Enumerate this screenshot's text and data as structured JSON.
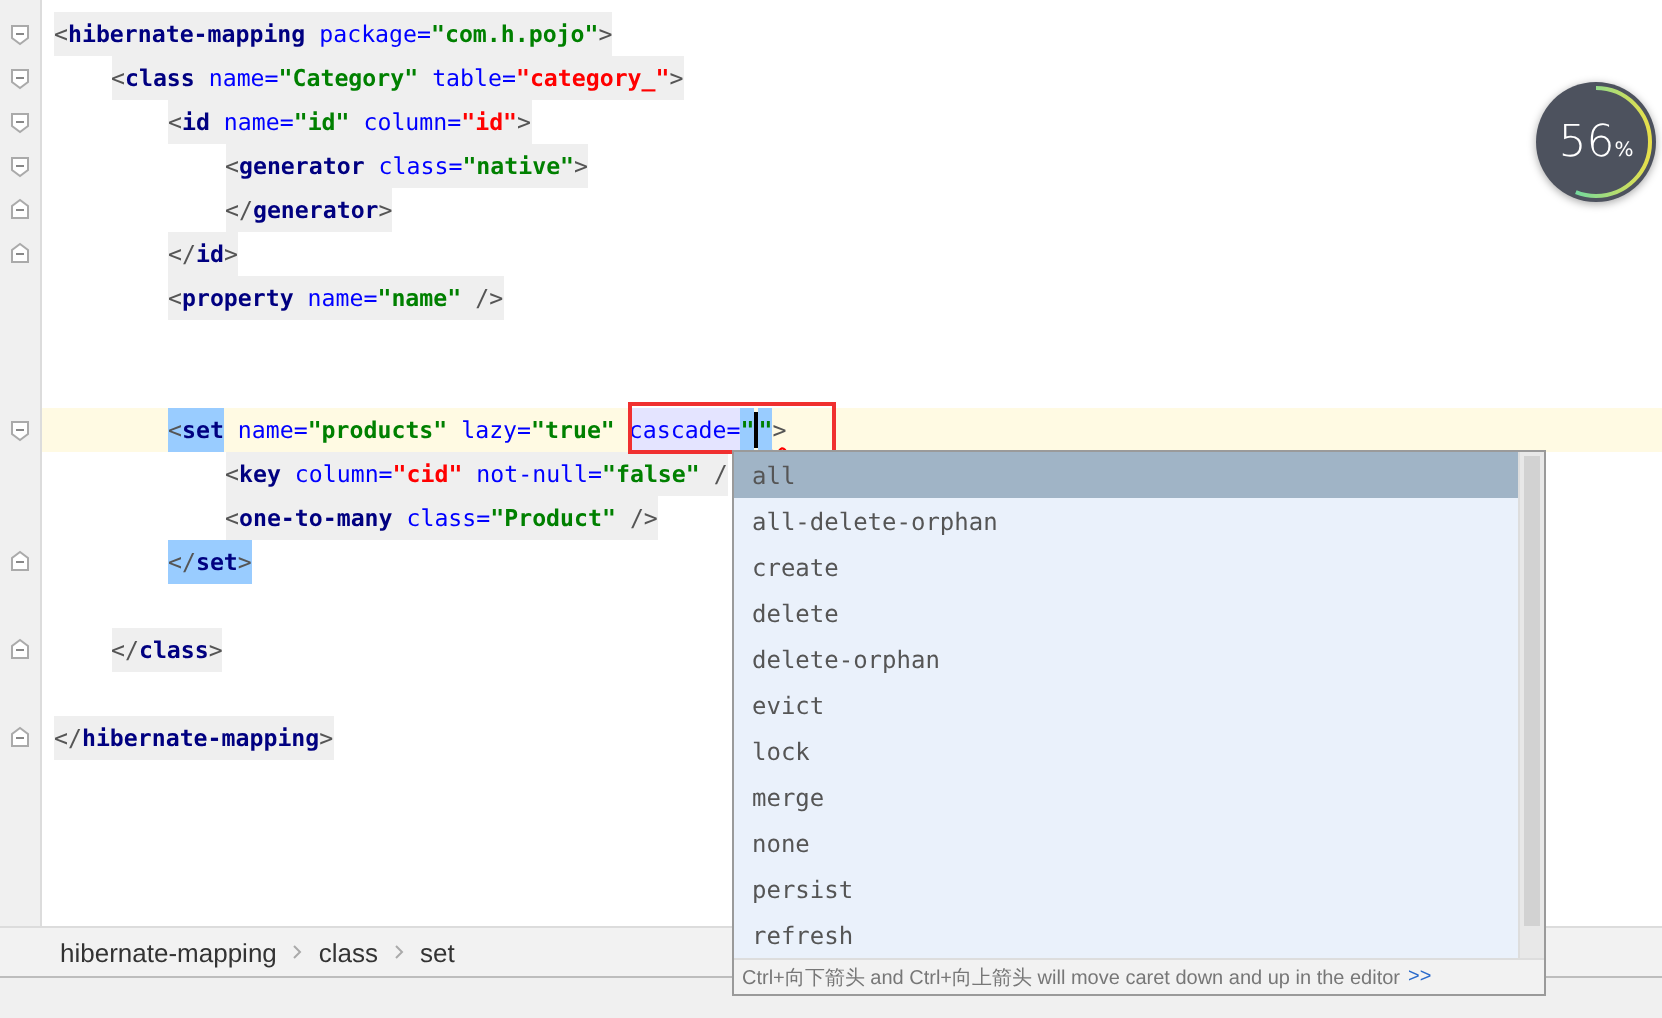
{
  "editor": {
    "lines": [
      {
        "kind": "code",
        "fold_start": true,
        "current": false,
        "tokens": [
          {
            "kind": "bracket",
            "text": "<"
          },
          {
            "kind": "tag",
            "text": "hibernate-mapping"
          },
          {
            "kind": "attr",
            "text": " package="
          },
          {
            "kind": "value",
            "text": "\"com.h.pojo\""
          },
          {
            "kind": "bracket",
            "text": ">"
          }
        ],
        "children": [
          {
            "kind": "code",
            "fold_start": true,
            "current": false,
            "tokens": [
              {
                "kind": "bracket",
                "text": "<"
              },
              {
                "kind": "tag",
                "text": "class"
              },
              {
                "kind": "attr",
                "text": " name="
              },
              {
                "kind": "value",
                "text": "\"Category\""
              },
              {
                "kind": "attr",
                "text": " table="
              },
              {
                "kind": "ref",
                "text": "\"category_\""
              },
              {
                "kind": "bracket",
                "text": ">"
              }
            ],
            "children": [
              {
                "kind": "code",
                "fold_start": true,
                "current": false,
                "tokens": [
                  {
                    "kind": "bracket",
                    "text": "<"
                  },
                  {
                    "kind": "tag",
                    "text": "id"
                  },
                  {
                    "kind": "attr",
                    "text": " name="
                  },
                  {
                    "kind": "value",
                    "text": "\"id\""
                  },
                  {
                    "kind": "attr",
                    "text": " column="
                  },
                  {
                    "kind": "ref",
                    "text": "\"id\""
                  },
                  {
                    "kind": "bracket",
                    "text": ">"
                  }
                ],
                "children": [
                  {
                    "kind": "code",
                    "fold_start": true,
                    "current": false,
                    "tokens": [
                      {
                        "kind": "bracket",
                        "text": "<"
                      },
                      {
                        "kind": "tag",
                        "text": "generator"
                      },
                      {
                        "kind": "attr",
                        "text": " class="
                      },
                      {
                        "kind": "value",
                        "text": "\"native\""
                      },
                      {
                        "kind": "bracket",
                        "text": ">"
                      }
                    ]
                  },
                  {
                    "kind": "code",
                    "fold_end": true,
                    "current": false,
                    "tokens": [
                      {
                        "kind": "bracket",
                        "text": "</"
                      },
                      {
                        "kind": "tag",
                        "text": "generator"
                      },
                      {
                        "kind": "bracket",
                        "text": ">"
                      }
                    ]
                  }
                ]
              },
              {
                "kind": "code",
                "fold_end": true,
                "current": false,
                "tokens": [
                  {
                    "kind": "bracket",
                    "text": "</"
                  },
                  {
                    "kind": "tag",
                    "text": "id"
                  },
                  {
                    "kind": "bracket",
                    "text": ">"
                  }
                ]
              },
              {
                "kind": "code",
                "current": false,
                "tokens": [
                  {
                    "kind": "bracket",
                    "text": "<"
                  },
                  {
                    "kind": "tag",
                    "text": "property"
                  },
                  {
                    "kind": "attr",
                    "text": " name="
                  },
                  {
                    "kind": "value",
                    "text": "\"name\""
                  },
                  {
                    "kind": "bracket",
                    "text": " />"
                  }
                ]
              },
              {
                "kind": "blank"
              },
              {
                "kind": "blank"
              },
              {
                "kind": "code",
                "fold_start": true,
                "current": true,
                "tokens": [
                  {
                    "kind": "bracket",
                    "text": "<",
                    "matched": true
                  },
                  {
                    "kind": "tag",
                    "text": "set",
                    "matched": true
                  },
                  {
                    "kind": "attr",
                    "text": " name="
                  },
                  {
                    "kind": "value",
                    "text": "\"products\""
                  },
                  {
                    "kind": "attr",
                    "text": " lazy="
                  },
                  {
                    "kind": "value",
                    "text": "\"true\" "
                  },
                  {
                    "kind": "attr",
                    "text": "cascade=",
                    "focused": true
                  },
                  {
                    "kind": "value",
                    "text": "\"",
                    "matched": true
                  },
                  {
                    "kind": "caret"
                  },
                  {
                    "kind": "value",
                    "text": "\"",
                    "matched": true
                  },
                  {
                    "kind": "bracket",
                    "text": ">",
                    "error": true
                  }
                ],
                "children": [
                  {
                    "kind": "code",
                    "current": false,
                    "tokens": [
                      {
                        "kind": "bracket",
                        "text": "<"
                      },
                      {
                        "kind": "tag",
                        "text": "key"
                      },
                      {
                        "kind": "attr",
                        "text": " column="
                      },
                      {
                        "kind": "ref",
                        "text": "\"cid\""
                      },
                      {
                        "kind": "attr",
                        "text": " not-null="
                      },
                      {
                        "kind": "value",
                        "text": "\"false\""
                      },
                      {
                        "kind": "bracket",
                        "text": " /"
                      }
                    ]
                  },
                  {
                    "kind": "code",
                    "current": false,
                    "tokens": [
                      {
                        "kind": "bracket",
                        "text": "<"
                      },
                      {
                        "kind": "tag",
                        "text": "one-to-many"
                      },
                      {
                        "kind": "attr",
                        "text": " class="
                      },
                      {
                        "kind": "value",
                        "text": "\"Product\""
                      },
                      {
                        "kind": "bracket",
                        "text": " />"
                      }
                    ]
                  }
                ]
              },
              {
                "kind": "code",
                "fold_end": true,
                "current": false,
                "tokens": [
                  {
                    "kind": "bracket",
                    "text": "</",
                    "matched": true
                  },
                  {
                    "kind": "tag",
                    "text": "set",
                    "matched": true
                  },
                  {
                    "kind": "bracket",
                    "text": ">",
                    "matched": true
                  }
                ]
              },
              {
                "kind": "blank"
              }
            ]
          },
          {
            "kind": "code",
            "fold_end": true,
            "current": false,
            "tokens": [
              {
                "kind": "bracket",
                "text": "</"
              },
              {
                "kind": "tag",
                "text": "class"
              },
              {
                "kind": "bracket",
                "text": ">"
              }
            ]
          },
          {
            "kind": "blank"
          }
        ]
      },
      {
        "kind": "code",
        "fold_end": true,
        "current": false,
        "tokens": [
          {
            "kind": "bracket",
            "text": "</"
          },
          {
            "kind": "tag",
            "text": "hibernate-mapping"
          },
          {
            "kind": "bracket",
            "text": ">"
          }
        ]
      }
    ]
  },
  "completion": {
    "items": [
      {
        "label": "all",
        "selected": true
      },
      {
        "label": "all-delete-orphan",
        "selected": false
      },
      {
        "label": "create",
        "selected": false
      },
      {
        "label": "delete",
        "selected": false
      },
      {
        "label": "delete-orphan",
        "selected": false
      },
      {
        "label": "evict",
        "selected": false
      },
      {
        "label": "lock",
        "selected": false
      },
      {
        "label": "merge",
        "selected": false
      },
      {
        "label": "none",
        "selected": false
      },
      {
        "label": "persist",
        "selected": false
      },
      {
        "label": "refresh",
        "selected": false
      }
    ],
    "hint": "Ctrl+向下箭头 and Ctrl+向上箭头 will move caret down and up in the editor",
    "hint_link": ">>"
  },
  "breadcrumbs": [
    "hibernate-mapping",
    "class",
    "set"
  ],
  "meter": {
    "value": "56",
    "unit": "%",
    "level": 0.56
  }
}
